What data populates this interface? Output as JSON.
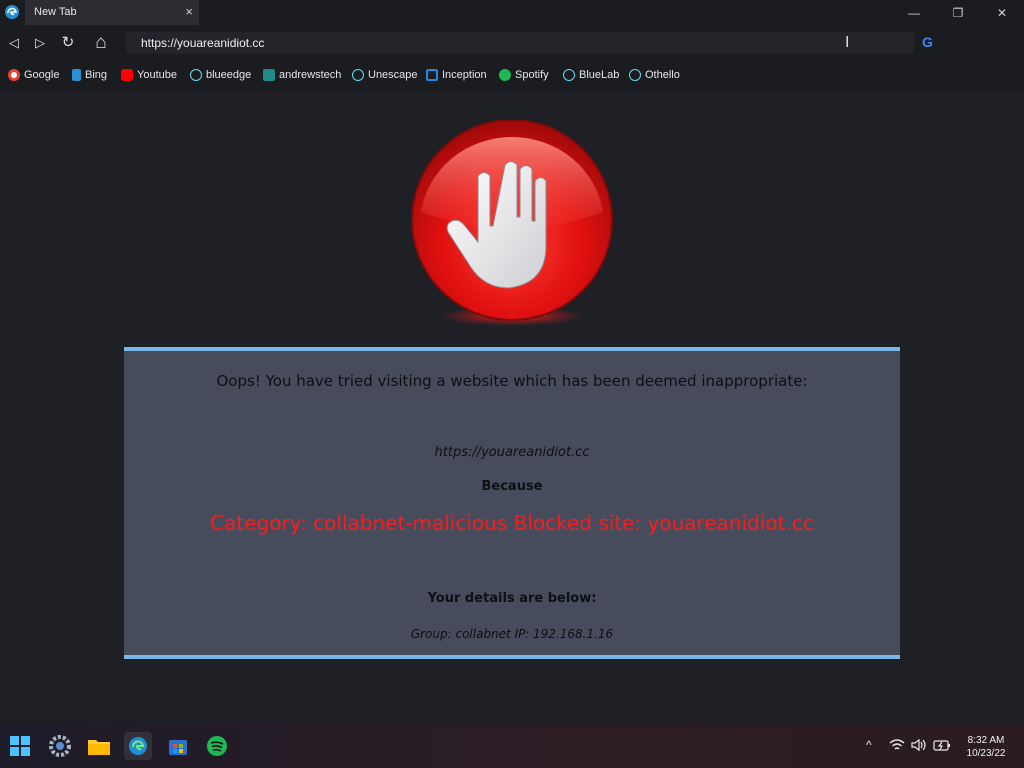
{
  "tabstrip": {
    "tab_title": "New Tab",
    "close_glyph": "×",
    "icon": "edge-browser-icon"
  },
  "window_controls": {
    "minimize": "—",
    "restore": "❐",
    "close": "✕"
  },
  "navbar": {
    "url": "https://youareanidiot.cc",
    "back": "◁",
    "forward": "▷",
    "reload": "↻",
    "home": "⌂",
    "search_engine_glyph": "G"
  },
  "bookmarks": [
    {
      "label": "Google",
      "icon": "google-icon",
      "color": "#ea4335"
    },
    {
      "label": "Bing",
      "icon": "bing-icon",
      "color": "#2b8fd6"
    },
    {
      "label": "Youtube",
      "icon": "youtube-icon",
      "color": "#ff0000"
    },
    {
      "label": "blueedge",
      "icon": "react-icon",
      "color": "#61dafb"
    },
    {
      "label": "andrewstech",
      "icon": "terminal-icon",
      "color": "#1f8a8a"
    },
    {
      "label": "Unescape",
      "icon": "react-icon",
      "color": "#61dafb"
    },
    {
      "label": "Inception",
      "icon": "inception-icon",
      "color": "#1e88e5"
    },
    {
      "label": "Spotify",
      "icon": "spotify-icon",
      "color": "#1db954"
    },
    {
      "label": "BlueLab",
      "icon": "react-icon",
      "color": "#61dafb"
    },
    {
      "label": "Othello",
      "icon": "react-icon",
      "color": "#61dafb"
    }
  ],
  "block_page": {
    "heading": "Oops! You have tried visiting a website which has been deemed inappropriate:",
    "blocked_url": "https://youareanidiot.cc",
    "because": "Because",
    "category": "Category: collabnet-malicious  Blocked site: youareanidiot.cc",
    "details_heading": "Your details are below:",
    "details": "Group: collabnet   IP: 192.168.1.16",
    "icon": "stop-hand-icon",
    "accent": "#7ab5ee",
    "category_color": "#ff1a1a"
  },
  "taskbar": {
    "apps": [
      "start-icon",
      "settings-icon",
      "file-explorer-icon",
      "edge-browser-icon",
      "store-icon",
      "spotify-icon"
    ],
    "tray": {
      "chevron": "^",
      "wifi": "wifi-icon",
      "volume": "volume-icon",
      "battery": "battery-icon"
    },
    "time": "8:32 AM",
    "date": "10/23/22"
  }
}
